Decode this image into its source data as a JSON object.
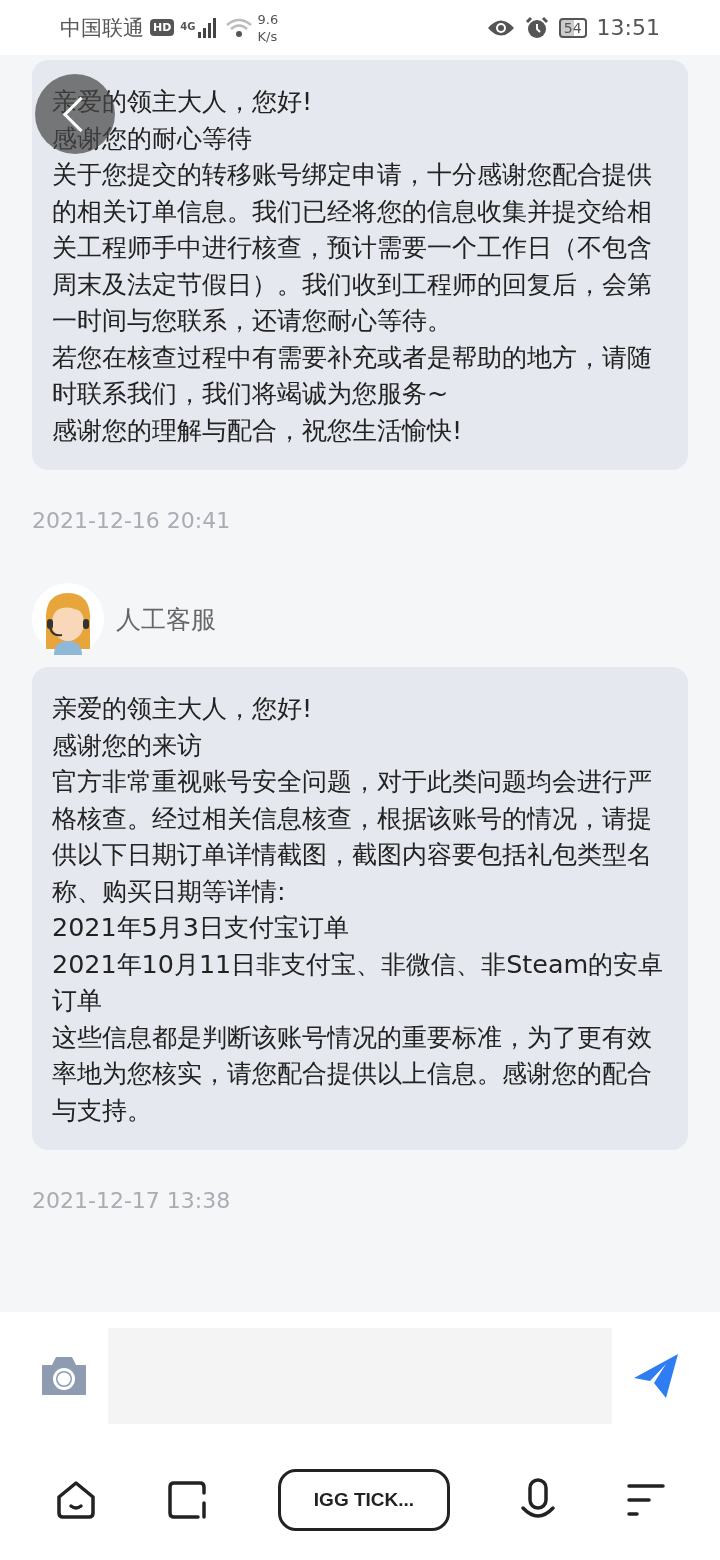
{
  "status_bar": {
    "carrier": "中国联通",
    "hd": "HD",
    "network": "4G",
    "speed_value": "9.6",
    "speed_unit": "K/s",
    "battery": "54",
    "time": "13:51"
  },
  "messages": [
    {
      "kind": "bubble",
      "paragraphs": [
        "亲爱的领主大人，您好!",
        "感谢您的耐心等待",
        "关于您提交的转移账号绑定申请，十分感谢您配合提供的相关订单信息。我们已经将您的信息收集并提交给相关工程师手中进行核查，预计需要一个工作日（不包含周末及法定节假日）。我们收到工程师的回复后，会第一时间与您联系，还请您耐心等待。",
        "若您在核查过程中有需要补充或者是帮助的地方，请随时联系我们，我们将竭诚为您服务~",
        "感谢您的理解与配合，祝您生活愉快!"
      ]
    },
    {
      "kind": "timestamp",
      "text": "2021-12-16 20:41"
    },
    {
      "kind": "sender",
      "name": "人工客服"
    },
    {
      "kind": "bubble",
      "paragraphs": [
        "亲爱的领主大人，您好!",
        "感谢您的来访",
        "官方非常重视账号安全问题，对于此类问题均会进行严格核查。经过相关信息核查，根据该账号的情况，请提供以下日期订单详情截图，截图内容要包括礼包类型名称、购买日期等详情:",
        "2021年5月3日支付宝订单",
        "2021年10月11日非支付宝、非微信、非Steam的安卓订单",
        "这些信息都是判断该账号情况的重要标准，为了更有效率地为您核实，请您配合提供以上信息。感谢您的配合与支持。"
      ]
    },
    {
      "kind": "timestamp",
      "text": "2021-12-17 13:38"
    }
  ],
  "nav": {
    "title": "IGG TICK..."
  }
}
